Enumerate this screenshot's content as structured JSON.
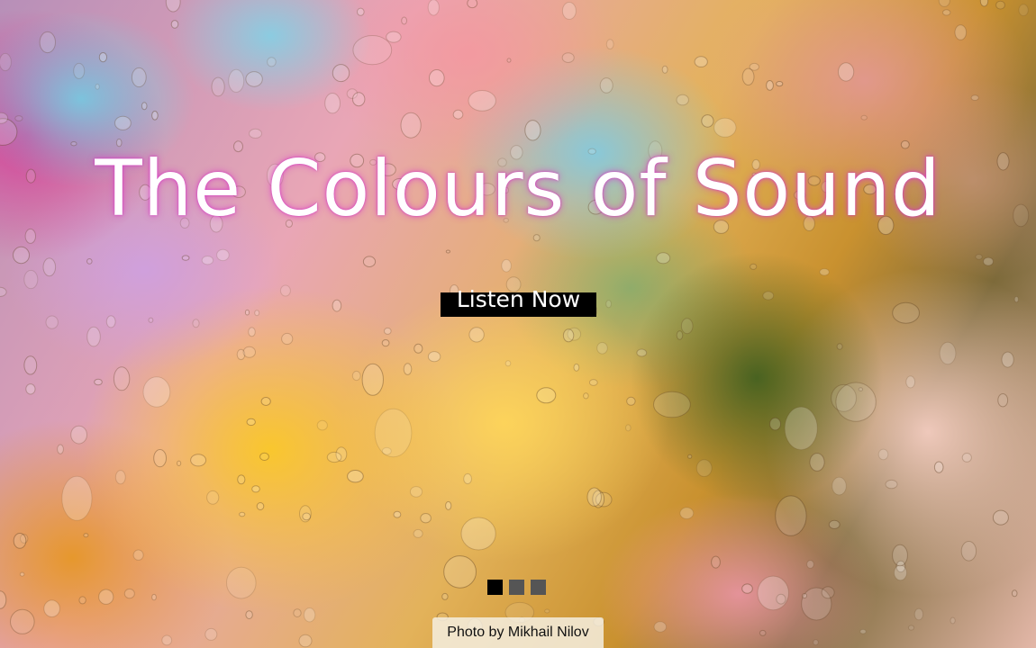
{
  "hero": {
    "title": "The Colours of Sound",
    "cta_label": "Listen Now",
    "photo_credit": "Photo by Mikhail Nilov"
  },
  "slider": {
    "total_slides": 3,
    "active_slide": 1
  },
  "colors": {
    "title_text": "#ffffff",
    "title_glow": "#dc3cc8",
    "button_bg": "#000000",
    "dot_active": "#000000",
    "dot_inactive": "#555555"
  }
}
